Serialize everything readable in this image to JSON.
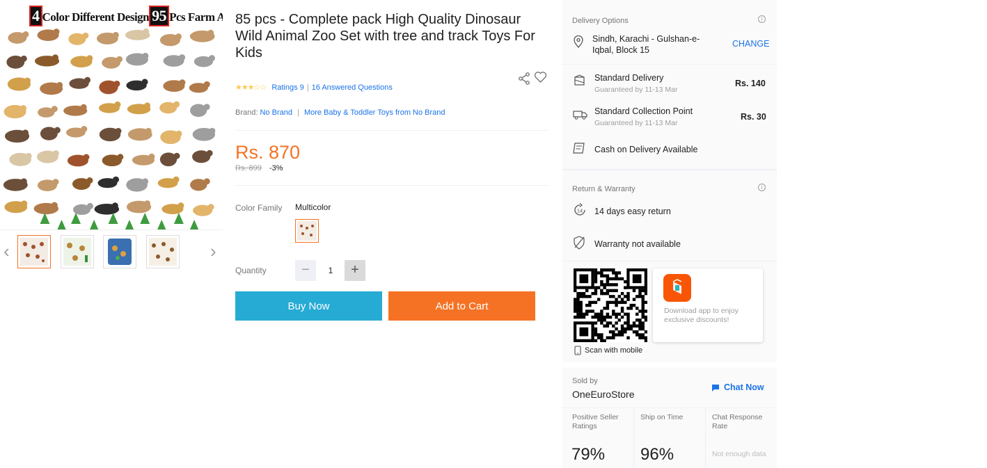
{
  "gallery": {
    "banner_num1": "4",
    "banner_text1": "Color Different Design",
    "banner_num2": "95",
    "banner_text2": "Pcs Farm Animal",
    "prev_icon": "chevron-left-icon",
    "next_icon": "chevron-right-icon",
    "thumbnails": [
      {
        "active": true
      },
      {
        "active": false
      },
      {
        "active": false
      },
      {
        "active": false
      }
    ]
  },
  "product": {
    "title": "85 pcs - Complete pack High Quality Dinosaur Wild Animal Zoo Set with tree and track Toys For Kids",
    "stars": "★★★☆☆",
    "rating_value": 3.5,
    "ratings_label": "Ratings 9",
    "questions_label": "16 Answered Questions",
    "brand_label": "Brand:",
    "brand_value": "No Brand",
    "more_link": "More Baby & Toddler Toys  from No Brand",
    "price": "Rs. 870",
    "old_price": "Rs. 899",
    "discount": "-3%",
    "color_family_label": "Color Family",
    "color_family_value": "Multicolor",
    "quantity_label": "Quantity",
    "quantity_value": "1",
    "minus": "−",
    "plus": "+",
    "buy_now": "Buy Now",
    "add_to_cart": "Add to Cart"
  },
  "delivery": {
    "title": "Delivery Options",
    "location": "Sindh, Karachi - Gulshan-e-Iqbal, Block 15",
    "change": "CHANGE",
    "options": [
      {
        "name": "Standard Delivery",
        "sub": "Guaranteed by 11-13 Mar",
        "price": "Rs. 140",
        "icon": "delivery-box-icon"
      },
      {
        "name": "Standard Collection Point",
        "sub": "Guaranteed by 11-13 Mar",
        "price": "Rs. 30",
        "icon": "truck-icon"
      }
    ],
    "cod": "Cash on Delivery Available"
  },
  "warranty": {
    "title": "Return & Warranty",
    "return": "14 days easy return",
    "return_badge": "14",
    "warranty": "Warranty not available"
  },
  "app": {
    "download_text": "Download app to enjoy exclusive discounts!",
    "scan": "Scan with mobile"
  },
  "seller": {
    "sold_by": "Sold by",
    "name": "OneEuroStore",
    "chat": "Chat Now",
    "metrics": [
      {
        "label": "Positive Seller Ratings",
        "value": "79%"
      },
      {
        "label": "Ship on Time",
        "value": "96%"
      },
      {
        "label": "Chat Response Rate",
        "value": "Not enough data"
      }
    ]
  },
  "colors": {
    "accent": "#f57224",
    "buy": "#26abd4",
    "link": "#1a73e8"
  }
}
